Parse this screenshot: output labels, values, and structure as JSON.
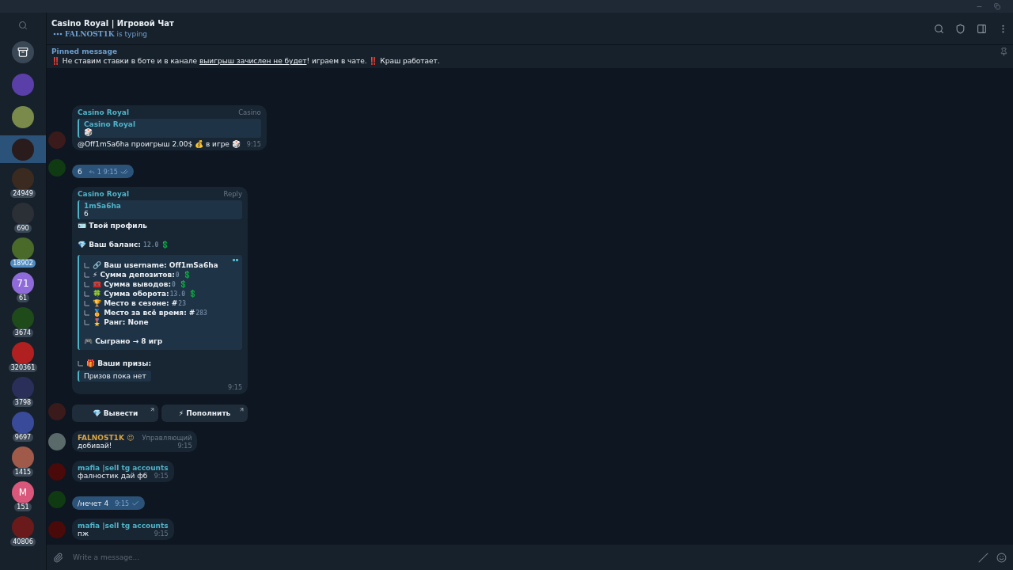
{
  "sidebar": {
    "items": [
      {
        "kind": "archive",
        "selected": false
      },
      {
        "kind": "photo",
        "color": "#5a3fa8",
        "selected": false
      },
      {
        "kind": "photo",
        "color": "#7a8a4a",
        "selected": false
      },
      {
        "kind": "photo",
        "color": "#2a1c1c",
        "selected": true
      },
      {
        "kind": "photo",
        "color": "#3a2a20",
        "badge": "24949",
        "selected": false
      },
      {
        "kind": "photo",
        "color": "#2b2f36",
        "badge": "690",
        "selected": false
      },
      {
        "kind": "photo",
        "color": "#4a6a2a",
        "badge": "18902",
        "badge_active": true,
        "selected": false
      },
      {
        "kind": "initials",
        "initials": "71",
        "color": "#8e6bd8",
        "badge": "61",
        "selected": false
      },
      {
        "kind": "photo",
        "color": "#1f4a1a",
        "badge": "3674",
        "selected": false
      },
      {
        "kind": "photo",
        "color": "#b02020",
        "badge": "320361",
        "selected": false
      },
      {
        "kind": "photo",
        "color": "#2a2f5a",
        "badge": "3798",
        "selected": false
      },
      {
        "kind": "photo",
        "color": "#3a4a9a",
        "badge": "9697",
        "selected": false
      },
      {
        "kind": "photo",
        "color": "#a05a4a",
        "badge": "1415",
        "selected": false
      },
      {
        "kind": "initials",
        "initials": "M",
        "color": "#d9577a",
        "badge": "151",
        "selected": false
      },
      {
        "kind": "photo",
        "color": "#6a1a1a",
        "badge": "40806",
        "selected": false
      }
    ]
  },
  "header": {
    "title": "Casino Royal | Игровой Чат",
    "typing_user": "FALNOST1K",
    "typing_text": "is typing"
  },
  "pinned": {
    "label": "Pinned message",
    "parts": [
      {
        "text": "‼️ Не ставим ставки в боте и в канале ",
        "underline": false
      },
      {
        "text": "выигрыш зачислен не будет",
        "underline": true
      },
      {
        "text": "! играем в чате. ‼️ Краш работает.",
        "underline": false
      }
    ]
  },
  "messages": [
    {
      "kind": "result",
      "sender": "Casino Royal",
      "color": "#4fb3c8",
      "tag": "Casino",
      "quote": {
        "author": "Casino Royal",
        "text": "🎲"
      },
      "text": "@Off1mSa6ha проигрыш 2.00$ 💰 в игре 🎲",
      "time": "9:15",
      "avatar": {
        "color": "#3a1a1a"
      }
    },
    {
      "kind": "outgoing",
      "text": "6",
      "replies": "1",
      "time": "9:15",
      "read": true,
      "avatar": {
        "color": "#0f3a12"
      }
    },
    {
      "kind": "profile",
      "sender": "Casino Royal",
      "color": "#4fb3c8",
      "tag": "Reply",
      "quote": {
        "author": "1mSa6ha",
        "text": "6"
      },
      "title": "🪪 Твой профиль",
      "balance_label": "💎 Ваш баланс:",
      "balance_value": "12.0",
      "balance_suffix": "💲",
      "stats": [
        {
          "label": "🔗 Ваш username: Off1mSa6ha"
        },
        {
          "label": "⚡ Сумма депозитов:",
          "value": "0",
          "suffix": "💲"
        },
        {
          "label": "🧰 Сумма выводов:",
          "value": "0",
          "suffix": "💲"
        },
        {
          "label": "🍀 Сумма оборота:",
          "value": "13.0",
          "suffix": "💲"
        },
        {
          "label": "🏆 Место в сезоне: #",
          "value": "23"
        },
        {
          "label": "🏅 Место за всё время: #",
          "value": "283"
        },
        {
          "label": "🎖️ Ранг: None"
        }
      ],
      "played": "🎮 Сыграно → 8 игр",
      "prizes_label": "🎁 Ваши призы:",
      "prizes": "Призов пока нет",
      "time": "9:15",
      "buttons": [
        {
          "label": "💎 Вывести"
        },
        {
          "label": "⚡ Пополнить"
        }
      ],
      "avatar": {
        "color": "#3a1a1a"
      }
    },
    {
      "kind": "incoming",
      "sender": "FALNOST1K 😉",
      "color": "#d9a441",
      "tag": "Управляющий",
      "text": "добивай!",
      "time": "9:15",
      "avatar": {
        "color": "#5a6a6a"
      }
    },
    {
      "kind": "incoming",
      "sender": "mafia |sell tg accounts",
      "color": "#4fb3c8",
      "text": "фалностик дай фб",
      "time": "9:15",
      "avatar": {
        "color": "#4a0a0a"
      }
    },
    {
      "kind": "outgoing",
      "text": "/нечет 4",
      "time": "9:15",
      "read": false,
      "avatar": {
        "color": "#0f3a12"
      }
    },
    {
      "kind": "incoming",
      "sender": "mafia |sell tg accounts",
      "color": "#4fb3c8",
      "text": "пж",
      "time": "9:15",
      "avatar": {
        "color": "#4a0a0a"
      }
    }
  ],
  "composer": {
    "placeholder": "Write a message..."
  }
}
